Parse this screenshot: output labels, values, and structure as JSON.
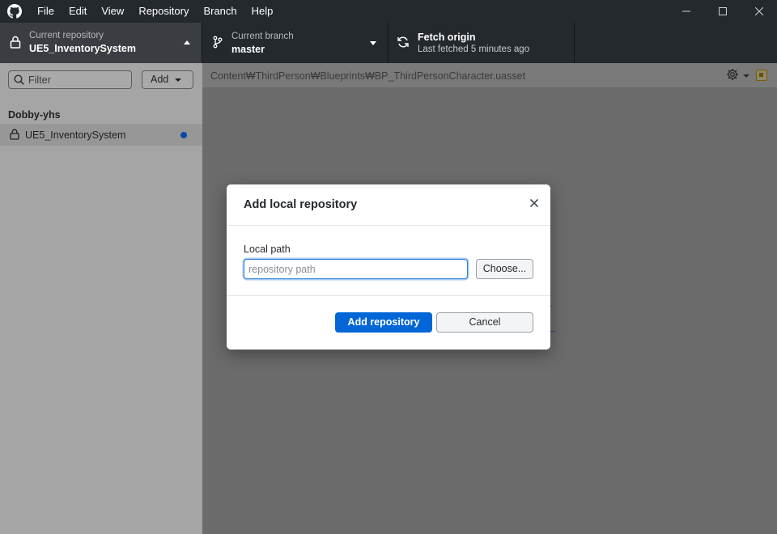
{
  "menu": [
    "File",
    "Edit",
    "View",
    "Repository",
    "Branch",
    "Help"
  ],
  "toolbar": {
    "repo_label": "Current repository",
    "repo_value": "UE5_InventorySystem",
    "branch_label": "Current branch",
    "branch_value": "master",
    "fetch_label": "Fetch origin",
    "fetch_sub": "Last fetched 5 minutes ago"
  },
  "sidebar": {
    "filter_placeholder": "Filter",
    "add_label": "Add",
    "group": "Dobby-yhs",
    "repos": [
      {
        "name": "UE5_InventorySystem",
        "has_changes": true
      }
    ]
  },
  "main": {
    "path": "Content₩ThirdPerson₩Blueprints₩BP_ThirdPersonCharacter.uasset"
  },
  "dialog": {
    "title": "Add local repository",
    "field_label": "Local path",
    "input_placeholder": "repository path",
    "input_value": "",
    "choose_label": "Choose...",
    "primary_label": "Add repository",
    "cancel_label": "Cancel"
  },
  "colors": {
    "titlebar": "#24292e",
    "primary": "#0366d6",
    "change_dot": "#0b48a6"
  }
}
